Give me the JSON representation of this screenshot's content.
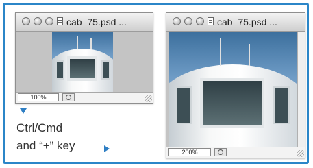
{
  "windows": [
    {
      "title": "cab_75.psd ...",
      "zoom": "100%"
    },
    {
      "title": "cab_75.psd ...",
      "zoom": "200%"
    }
  ],
  "caption": {
    "line1": "Ctrl/Cmd",
    "line2": "and “+” key"
  },
  "colors": {
    "frame": "#2b86c8",
    "arrow": "#2f7fc4"
  },
  "icons": [
    "window-close-icon",
    "window-minimize-icon",
    "window-zoom-icon",
    "document-icon",
    "navigator-icon",
    "resize-grip-icon",
    "arrow-down-icon",
    "arrow-right-icon"
  ]
}
